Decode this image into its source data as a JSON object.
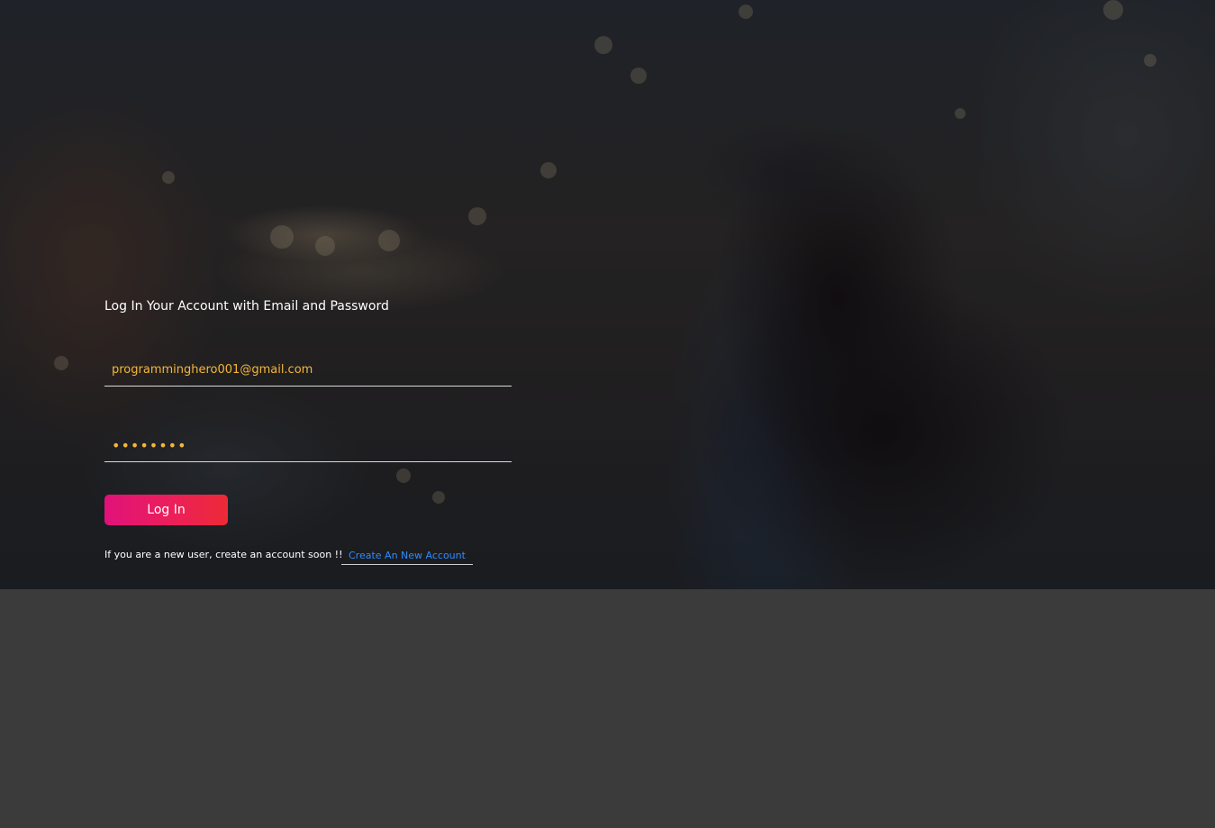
{
  "hero": {
    "background_image": "night-city-photographer-with-camera"
  },
  "login_form": {
    "title": "Log In Your Account with Email and Password",
    "email": {
      "value": "programminghero001@gmail.com",
      "placeholder": ""
    },
    "password": {
      "value": "12345678",
      "type": "password"
    },
    "login_button_label": "Log In",
    "signup_prompt": "If you are a new user, create an account soon !!",
    "signup_link_label": "Create An New Account"
  },
  "colors": {
    "page_background": "#3b3b3b",
    "input_text": "#f4b63a",
    "button_gradient_start": "#e0127a",
    "button_gradient_end": "#ed2a36",
    "link": "#2f8cff"
  }
}
